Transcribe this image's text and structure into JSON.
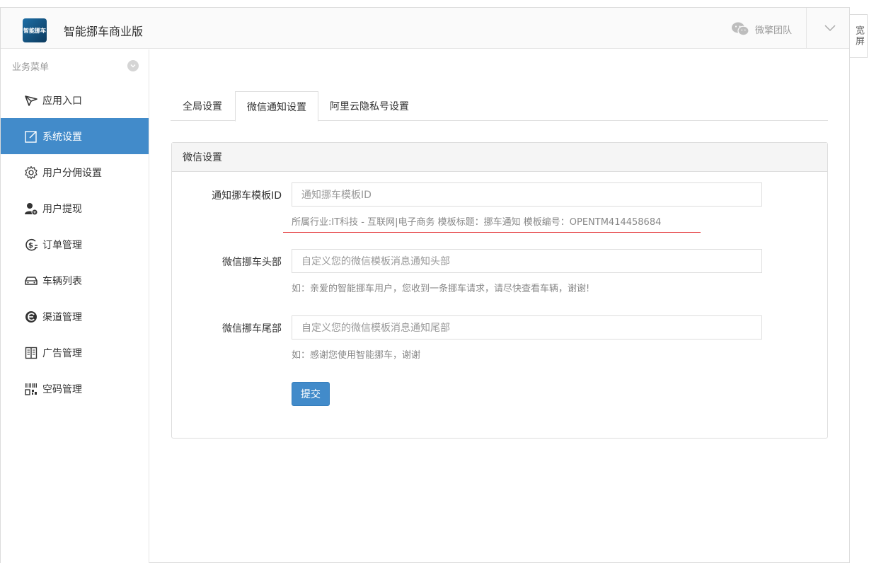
{
  "header": {
    "logo_text": "智能挪车",
    "app_title": "智能挪车商业版",
    "team_label": "微擎团队",
    "wide_label": "宽屏"
  },
  "sidebar": {
    "title": "业务菜单",
    "items": [
      {
        "label": "应用入口",
        "icon": "paper-plane-icon"
      },
      {
        "label": "系统设置",
        "icon": "edit-icon",
        "active": true
      },
      {
        "label": "用户分佣设置",
        "icon": "gear-icon"
      },
      {
        "label": "用户提现",
        "icon": "user-money-icon"
      },
      {
        "label": "订单管理",
        "icon": "dollar-refresh-icon"
      },
      {
        "label": "车辆列表",
        "icon": "car-icon"
      },
      {
        "label": "渠道管理",
        "icon": "channel-icon"
      },
      {
        "label": "广告管理",
        "icon": "book-icon"
      },
      {
        "label": "空码管理",
        "icon": "barcode-icon"
      }
    ]
  },
  "tabs": [
    {
      "label": "全局设置"
    },
    {
      "label": "微信通知设置",
      "active": true
    },
    {
      "label": "阿里云隐私号设置"
    }
  ],
  "panel": {
    "title": "微信设置",
    "fields": [
      {
        "label": "通知挪车模板ID",
        "placeholder": "通知挪车模板ID",
        "help": "所属行业:IT科技 - 互联网|电子商务 模板标题：挪车通知 模板编号：OPENTM414458684"
      },
      {
        "label": "微信挪车头部",
        "placeholder": "自定义您的微信模板消息通知头部",
        "help": "如：亲爱的智能挪车用户，您收到一条挪车请求，请尽快查看车辆，谢谢!"
      },
      {
        "label": "微信挪车尾部",
        "placeholder": "自定义您的微信模板消息通知尾部",
        "help": "如：感谢您使用智能挪车，谢谢"
      }
    ],
    "submit_label": "提交"
  },
  "colors": {
    "accent": "#428bca",
    "highlight_line": "#e4393c"
  }
}
